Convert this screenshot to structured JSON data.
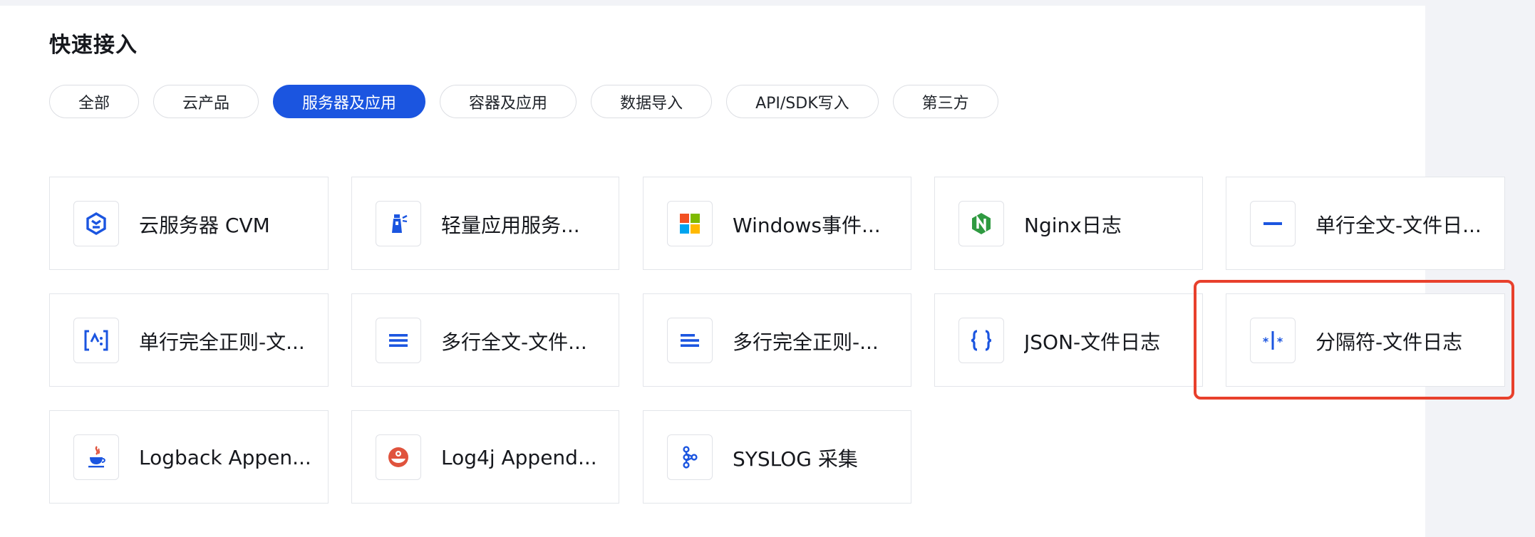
{
  "section": {
    "title": "快速接入"
  },
  "filters": [
    {
      "label": "全部",
      "active": false
    },
    {
      "label": "云产品",
      "active": false
    },
    {
      "label": "服务器及应用",
      "active": true
    },
    {
      "label": "容器及应用",
      "active": false
    },
    {
      "label": "数据导入",
      "active": false
    },
    {
      "label": "API/SDK写入",
      "active": false
    },
    {
      "label": "第三方",
      "active": false
    }
  ],
  "cards": [
    {
      "label": "云服务器 CVM",
      "icon": "cvm-icon"
    },
    {
      "label": "轻量应用服务...",
      "icon": "lighthouse-icon"
    },
    {
      "label": "Windows事件...",
      "icon": "windows-icon"
    },
    {
      "label": "Nginx日志",
      "icon": "nginx-icon"
    },
    {
      "label": "单行全文-文件日...",
      "icon": "single-line-icon"
    },
    {
      "label": "单行完全正则-文...",
      "icon": "regex-icon"
    },
    {
      "label": "多行全文-文件...",
      "icon": "multi-line-icon"
    },
    {
      "label": "多行完全正则-...",
      "icon": "multi-line-regex-icon"
    },
    {
      "label": "JSON-文件日志",
      "icon": "json-icon"
    },
    {
      "label": "分隔符-文件日志",
      "icon": "delimiter-icon"
    },
    {
      "label": "Logback Appen...",
      "icon": "java-icon"
    },
    {
      "label": "Log4j Append...",
      "icon": "log4j-icon"
    },
    {
      "label": "SYSLOG 采集",
      "icon": "syslog-icon"
    }
  ],
  "colors": {
    "accent": "#1b55e0",
    "highlight": "#e8402c",
    "nginx": "#2f9a41",
    "log4j": "#e0533d"
  }
}
